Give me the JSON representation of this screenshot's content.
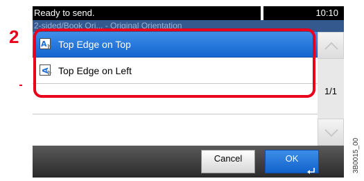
{
  "callout": {
    "step": "2"
  },
  "status_bar": {
    "message": "Ready to send.",
    "time": "10:10"
  },
  "breadcrumb": {
    "text": "2-sided/Book Ori... - Original Orientation"
  },
  "options": [
    {
      "label": "Top Edge on Top",
      "icon": "top-edge-on-top-icon",
      "selected": true
    },
    {
      "label": "Top Edge on Left",
      "icon": "top-edge-on-left-icon",
      "selected": false
    }
  ],
  "pagination": {
    "indicator": "1/1"
  },
  "buttons": {
    "cancel": "Cancel",
    "ok": "OK"
  },
  "figure_code": "3B0015_00",
  "colors": {
    "accent": "#1a6fd6",
    "highlight": "#e8001c",
    "status_bar": "#000000",
    "breadcrumb": "#33598f"
  }
}
